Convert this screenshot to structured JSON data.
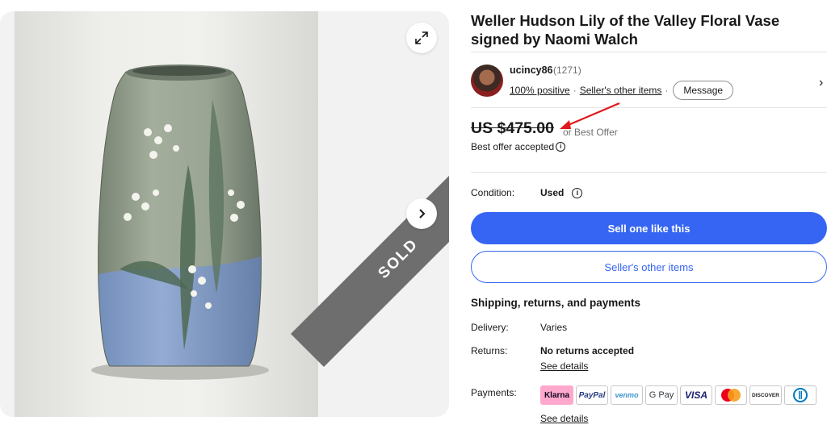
{
  "gallery": {
    "sold_label": "SOLD",
    "expand_icon": "expand-arrows-icon",
    "next_icon": "chevron-right-icon"
  },
  "listing": {
    "title": "Weller Hudson Lily of the Valley Floral Vase signed by Naomi Walch"
  },
  "seller": {
    "name": "ucincy86",
    "feedback_count": "(1271)",
    "positive": "100% positive",
    "separator": "·",
    "other_items": "Seller's other items",
    "message_label": "Message"
  },
  "price": {
    "amount": "US $475.00",
    "offer_text": "or Best Offer",
    "offer_accepted": "Best offer accepted"
  },
  "condition": {
    "label": "Condition:",
    "value": "Used"
  },
  "actions": {
    "sell_one": "Sell one like this",
    "sellers_other_items": "Seller's other items"
  },
  "shipping": {
    "heading": "Shipping, returns, and payments",
    "delivery_label": "Delivery:",
    "delivery_value": "Varies",
    "returns_label": "Returns:",
    "returns_value": "No returns accepted",
    "see_details": "See details",
    "payments_label": "Payments:",
    "payment_methods": [
      "Klarna",
      "PayPal",
      "venmo",
      "G Pay",
      "VISA",
      "Mastercard",
      "DISCOVER",
      "Diners Club"
    ]
  },
  "colors": {
    "accent_blue": "#3665f3",
    "annotation_red": "#e0191c",
    "sold_ribbon": "#6e6e6e"
  }
}
